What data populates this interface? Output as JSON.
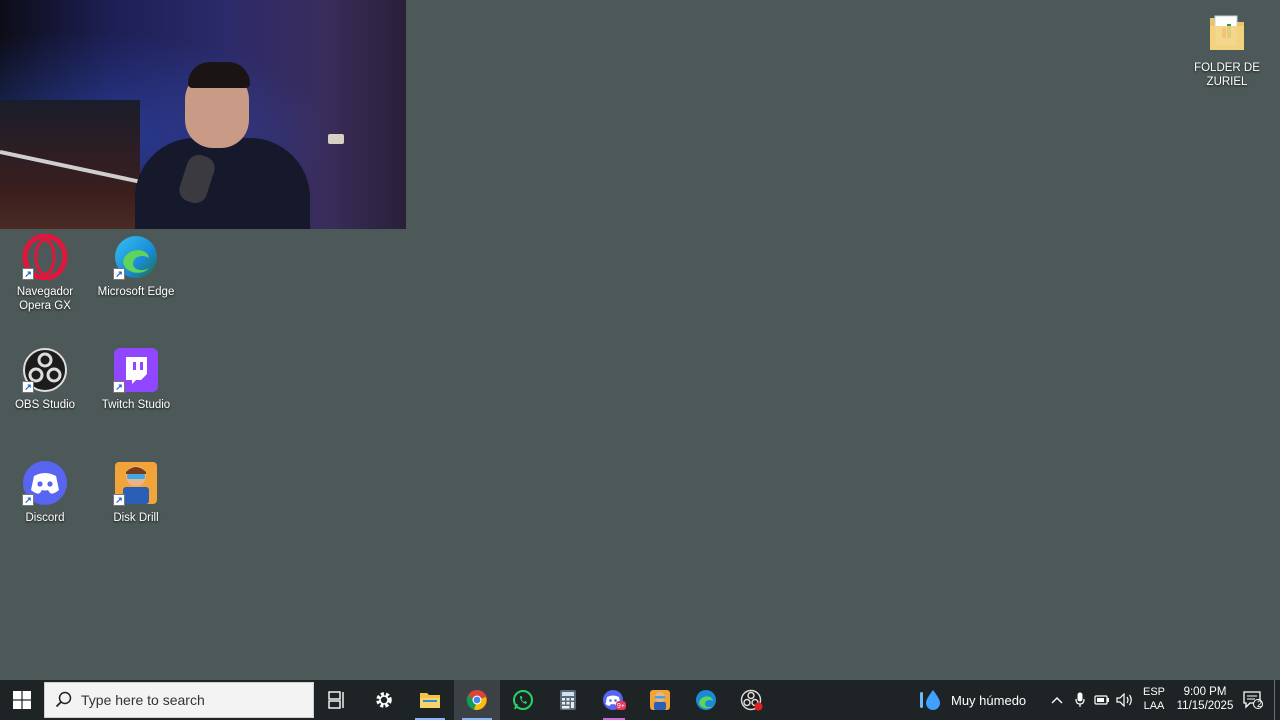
{
  "desktop": {
    "background_color": "#4d5858",
    "icons": [
      {
        "label": "Navegador Opera GX",
        "icon": "opera-gx-icon"
      },
      {
        "label": "Microsoft Edge",
        "icon": "edge-icon"
      },
      {
        "label": "OBS Studio",
        "icon": "obs-icon"
      },
      {
        "label": "Twitch Studio",
        "icon": "twitch-icon"
      },
      {
        "label": "Discord",
        "icon": "discord-icon"
      },
      {
        "label": "Disk Drill",
        "icon": "disk-drill-icon"
      },
      {
        "label": "FOLDER DE ZURIEL",
        "icon": "folder-icon"
      }
    ]
  },
  "taskbar": {
    "search_placeholder": "Type here to search",
    "apps": [
      {
        "name": "task-view",
        "icon": "task-view-icon"
      },
      {
        "name": "settings",
        "icon": "gear-icon"
      },
      {
        "name": "file-explorer",
        "icon": "folder-icon"
      },
      {
        "name": "chrome",
        "icon": "chrome-icon"
      },
      {
        "name": "whatsapp",
        "icon": "whatsapp-icon"
      },
      {
        "name": "calculator",
        "icon": "calculator-icon"
      },
      {
        "name": "discord",
        "icon": "discord-icon",
        "badge": "9+"
      },
      {
        "name": "disk-drill",
        "icon": "disk-drill-icon"
      },
      {
        "name": "edge",
        "icon": "edge-icon"
      },
      {
        "name": "obs",
        "icon": "obs-icon"
      }
    ],
    "weather": {
      "text": "Muy húmedo",
      "icon": "water-drop-icon"
    },
    "language": {
      "line1": "ESP",
      "line2": "LAA"
    },
    "clock": {
      "time": "9:00 PM",
      "date": "11/15/2025"
    },
    "notifications": {
      "count": "2"
    }
  },
  "colors": {
    "taskbar": "#1e2325",
    "accent": "#8ab4f8",
    "twitch": "#9146ff",
    "discord": "#5865f2"
  }
}
